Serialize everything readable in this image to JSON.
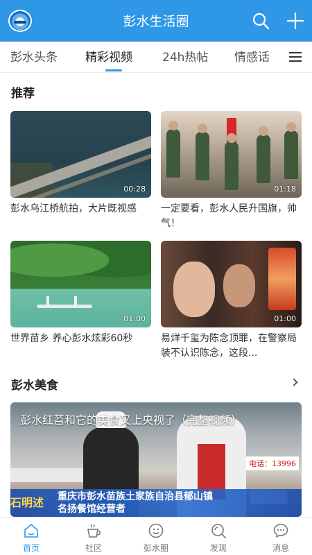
{
  "header": {
    "title": "彭水生活圈",
    "logo_icon": "city-logo-icon",
    "search_icon": "search-icon",
    "add_icon": "plus-icon",
    "color": "#2f98e6"
  },
  "tabs": [
    {
      "label": "彭水头条",
      "active": false
    },
    {
      "label": "精彩视频",
      "active": true
    },
    {
      "label": "24h热帖",
      "active": false
    },
    {
      "label": "情感话",
      "active": false
    }
  ],
  "tab_menu_icon": "menu-icon",
  "sections": {
    "recommend": {
      "title": "推荐",
      "videos": [
        {
          "title": "彭水乌江桥航拍，大片既视感",
          "duration": "00:28"
        },
        {
          "title": "一定要看，彭水人民升国旗，帅气！",
          "duration": "01:18"
        },
        {
          "title": "世界苗乡 养心彭水炫彩60秒",
          "duration": "01:00"
        },
        {
          "title": "易烊千玺为陈念顶罪，在警察局装不认识陈念，这段...",
          "duration": "01:00"
        }
      ]
    },
    "food": {
      "title": "彭水美食",
      "banner_title": "彭水红苕和它的美食又上央视了（完整视频）",
      "phone": "电话：13996",
      "strip_left": "石明述",
      "strip_text": "重庆市彭水苗族土家族自治县郁山镇 名扬餐馆经营者"
    }
  },
  "bottom_nav": [
    {
      "label": "首页",
      "icon": "home-icon",
      "active": true
    },
    {
      "label": "社区",
      "icon": "coffee-cup-icon",
      "active": false
    },
    {
      "label": "彭水圈",
      "icon": "smiley-icon",
      "active": false
    },
    {
      "label": "发现",
      "icon": "discover-search-icon",
      "active": false
    },
    {
      "label": "消息",
      "icon": "message-bubble-icon",
      "active": false
    }
  ]
}
